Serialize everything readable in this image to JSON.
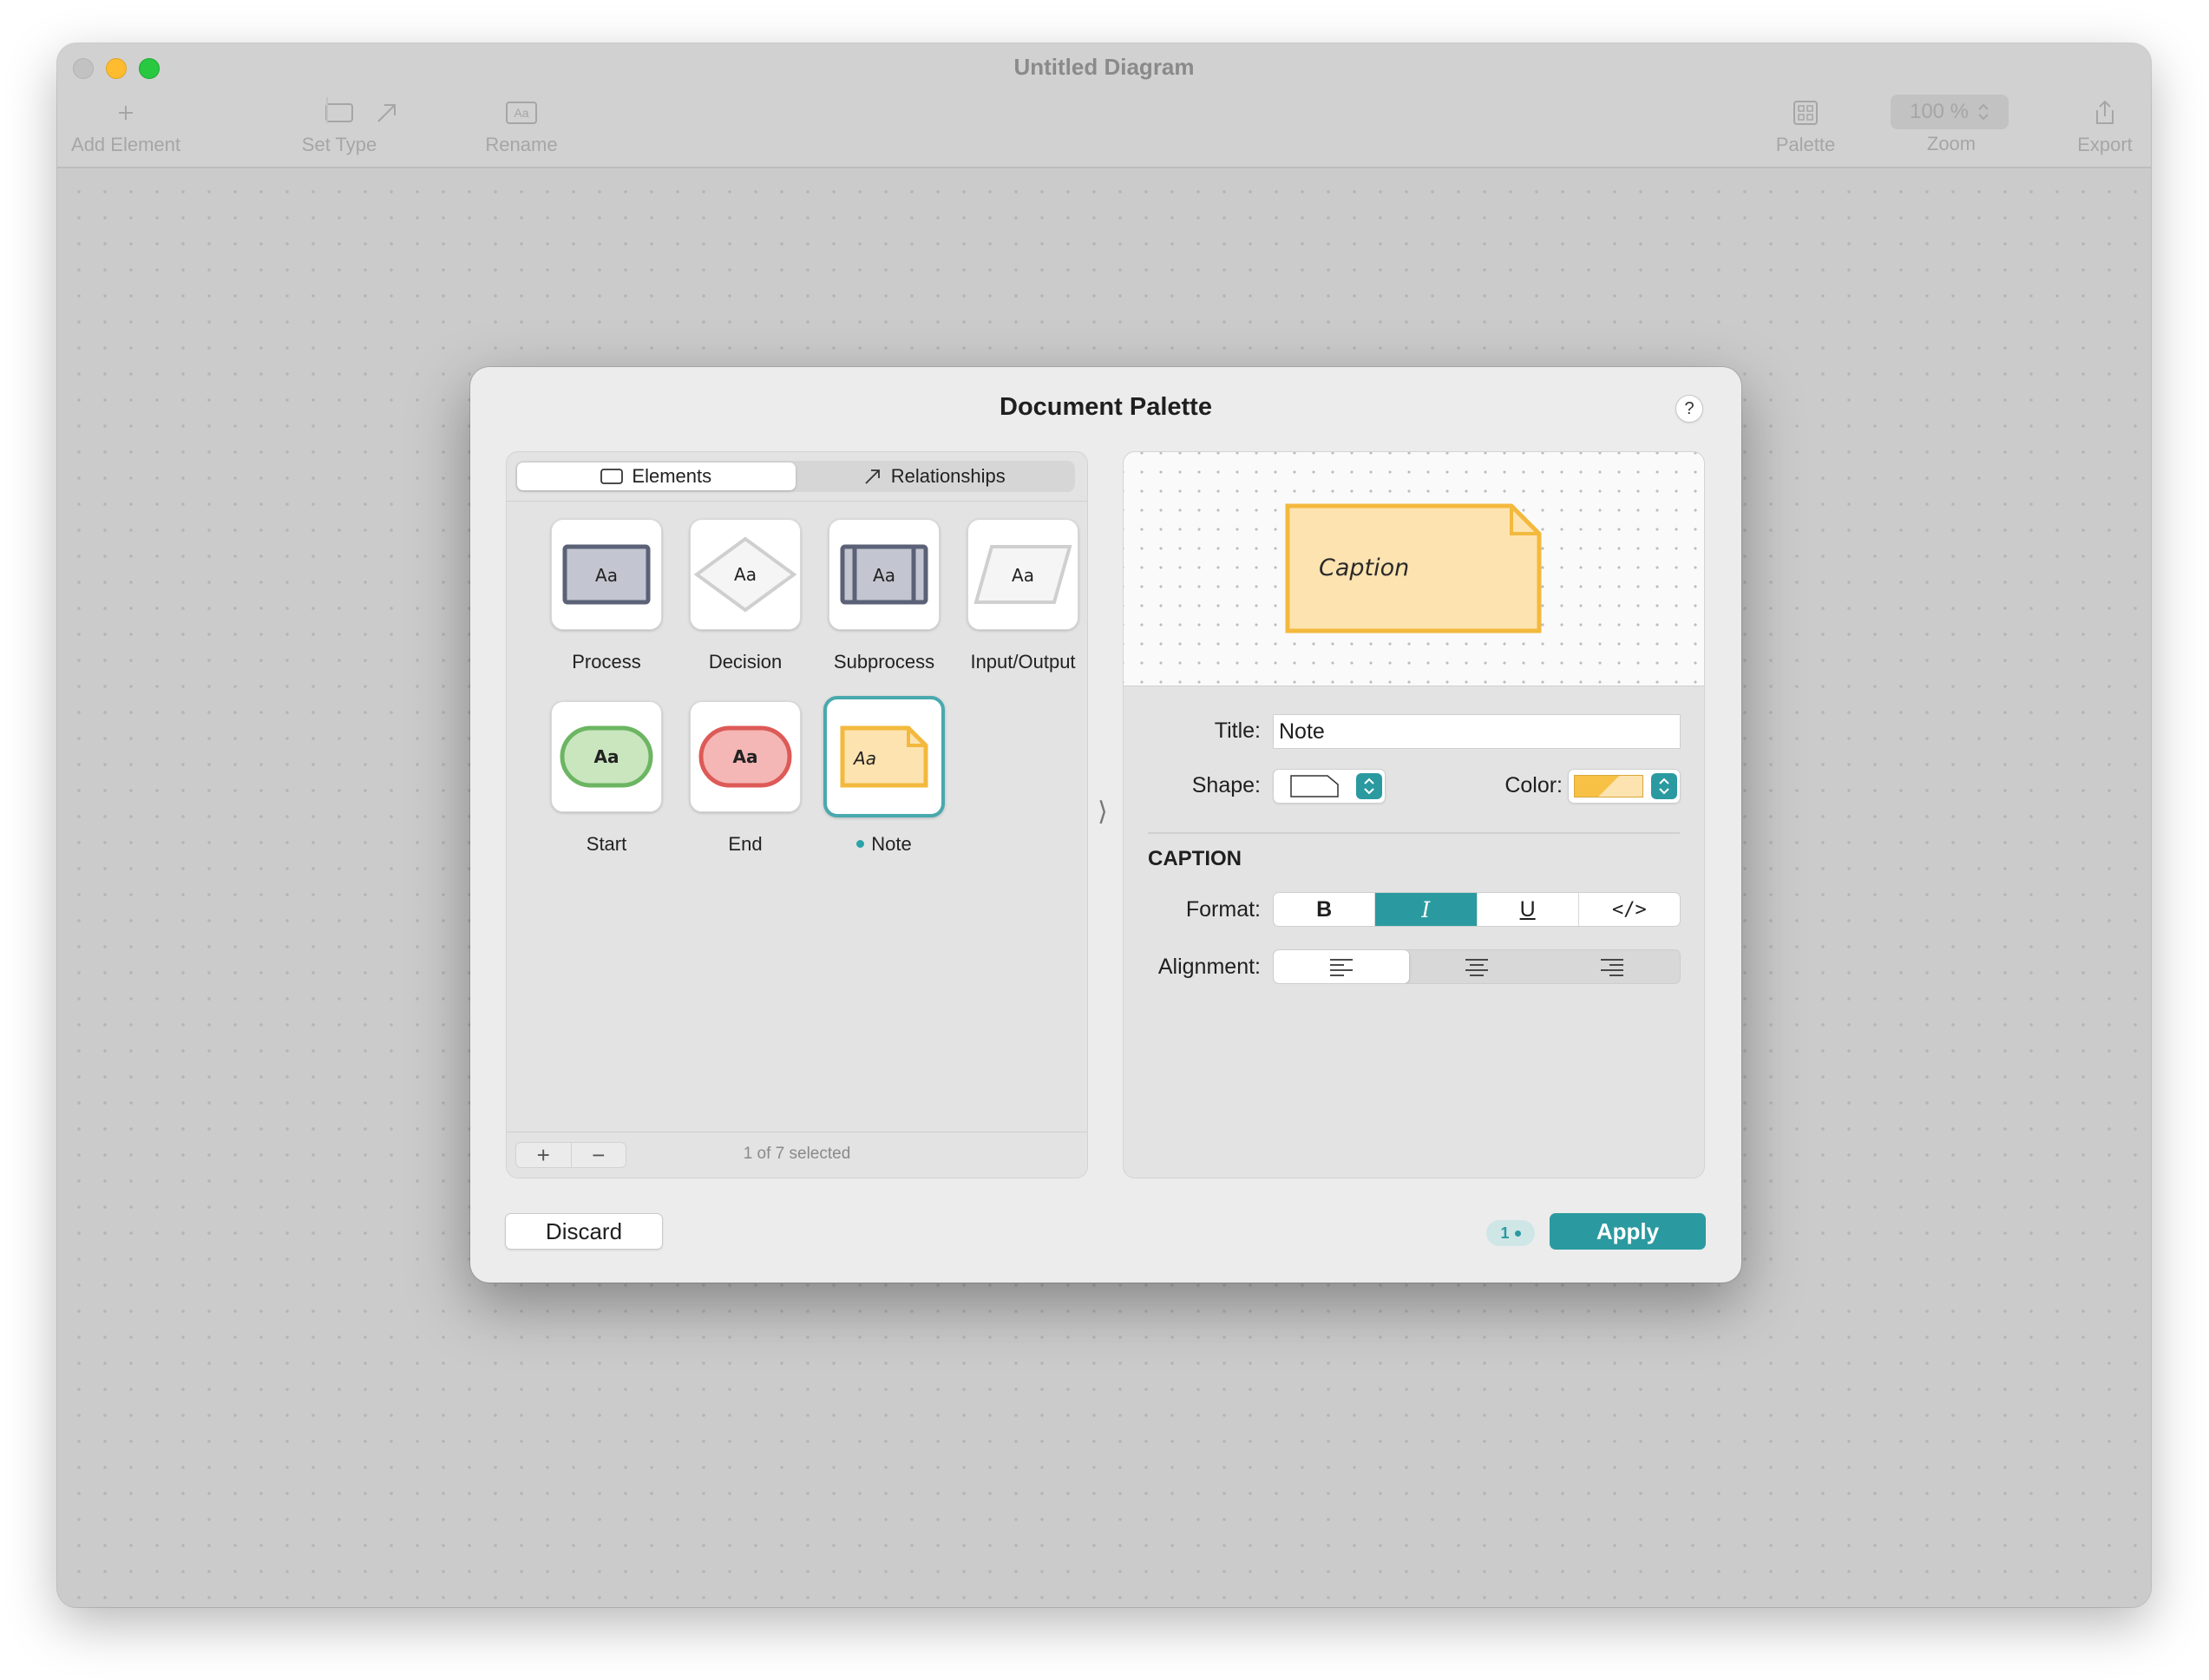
{
  "window": {
    "title": "Untitled Diagram"
  },
  "toolbar": {
    "add_element": "Add Element",
    "set_type": "Set Type",
    "rename": "Rename",
    "rename_icon_text": "Aa",
    "palette": "Palette",
    "zoom_label": "Zoom",
    "zoom_value": "100 %",
    "export": "Export"
  },
  "dialog": {
    "title": "Document Palette",
    "help": "?",
    "tabs": {
      "elements": "Elements",
      "relationships": "Relationships",
      "active": "Elements"
    },
    "elements": [
      {
        "label": "Process",
        "glyph": "Aa",
        "shape": "process",
        "fill": "#c3c6d0",
        "stroke": "#5b6176"
      },
      {
        "label": "Decision",
        "glyph": "Aa",
        "shape": "decision",
        "fill": "#f5f5f5",
        "stroke": "#cfcfcf"
      },
      {
        "label": "Subprocess",
        "glyph": "Aa",
        "shape": "subprocess",
        "fill": "#c3c6d0",
        "stroke": "#5b6176"
      },
      {
        "label": "Input/Output",
        "glyph": "Aa",
        "shape": "input-output",
        "fill": "#f5f5f5",
        "stroke": "#cfcfcf"
      },
      {
        "label": "Start",
        "glyph": "Aa",
        "shape": "terminal",
        "fill": "#c9e6bf",
        "stroke": "#6cb562"
      },
      {
        "label": "End",
        "glyph": "Aa",
        "shape": "terminal",
        "fill": "#f4b7b5",
        "stroke": "#dd5a57"
      },
      {
        "label": "Note",
        "glyph": "Aa",
        "shape": "note",
        "fill": "#fde3b0",
        "stroke": "#f3b93d",
        "selected": true
      }
    ],
    "add_button": "+",
    "remove_button": "−",
    "selection_status": "1 of 7 selected",
    "preview": {
      "caption": "Caption",
      "fill": "#fde3b0",
      "stroke": "#f3b93d"
    },
    "inspector": {
      "title_label": "Title:",
      "title_value": "Note",
      "shape_label": "Shape:",
      "shape_value": "note",
      "color_label": "Color:",
      "color_value": "#f8c95a",
      "section_heading": "CAPTION",
      "format_label": "Format:",
      "format_options": [
        "B",
        "I",
        "U",
        "</>"
      ],
      "format_active": "I",
      "alignment_label": "Alignment:",
      "alignment_options": [
        "align-left",
        "align-center",
        "align-right"
      ],
      "alignment_active": "align-left"
    },
    "discard_button": "Discard",
    "pending_badge": "1",
    "apply_button": "Apply"
  },
  "colors": {
    "accent": "#2a9aa0",
    "selection": "#48a9ae"
  }
}
